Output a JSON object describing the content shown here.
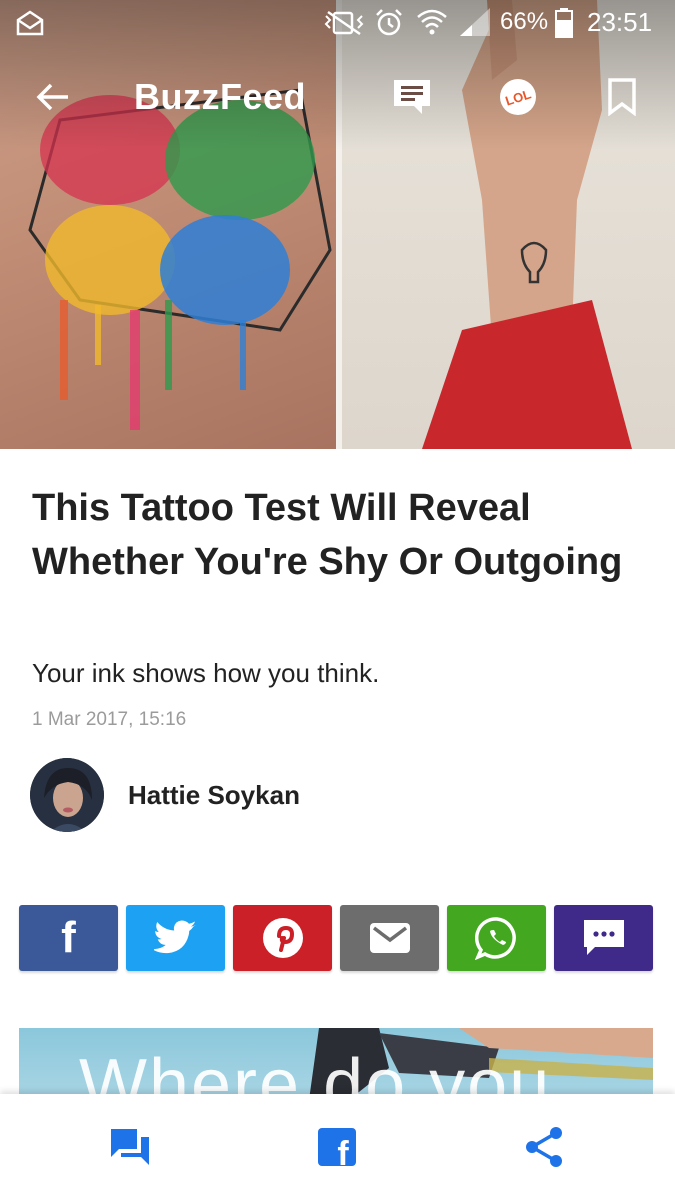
{
  "status_bar": {
    "battery_percent": "66%",
    "time": "23:51"
  },
  "top_bar": {
    "brand": "BuzzFeed",
    "lol_badge": "LOL"
  },
  "article": {
    "title": "This Tattoo Test Will Reveal Whether You're Shy Or Outgoing",
    "subtitle": "Your ink shows how you think.",
    "date": "1 Mar 2017, 15:16",
    "author": "Hattie Soykan"
  },
  "share_buttons": [
    {
      "name": "facebook",
      "color": "#3b5998",
      "glyph": "f"
    },
    {
      "name": "twitter",
      "color": "#1da1f2"
    },
    {
      "name": "pinterest",
      "color": "#cb2027"
    },
    {
      "name": "email",
      "color": "#6d6d6d"
    },
    {
      "name": "whatsapp",
      "color": "#43a81f"
    },
    {
      "name": "sms",
      "color": "#3f2a8a"
    }
  ],
  "next_image": {
    "text": "Where do you"
  },
  "bottom_bar": {
    "accent_color": "#1e73e8",
    "facebook_glyph": "f"
  }
}
